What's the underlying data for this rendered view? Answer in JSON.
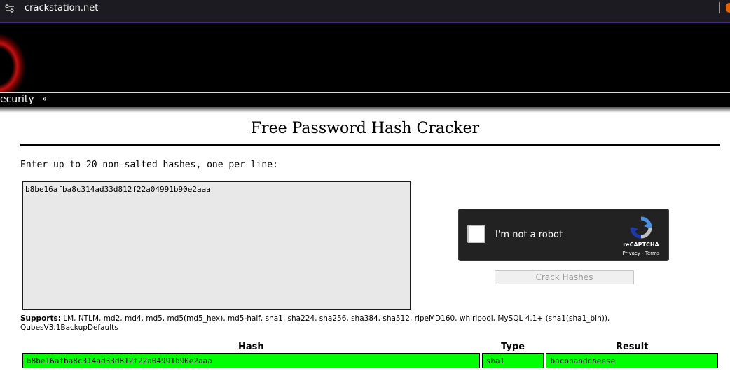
{
  "browser": {
    "url": "crackstation.net",
    "site_info_icon": "tune-icon"
  },
  "nav": {
    "label": "ecurity",
    "chevron": "»"
  },
  "page": {
    "title": "Free Password Hash Cracker",
    "instructions": "Enter up to 20 non-salted hashes, one per line:",
    "hash_input_value": "b8be16afba8c314ad33d812f22a04991b90e2aaa",
    "crack_button_label": "Crack Hashes",
    "supports_label": "Supports:",
    "supports_text": " LM, NTLM, md2, md4, md5, md5(md5_hex), md5-half, sha1, sha224, sha256, sha384, sha512, ripeMD160, whirlpool, MySQL 4.1+ (sha1(sha1_bin)), QubesV3.1BackupDefaults"
  },
  "captcha": {
    "label": "I'm not a robot",
    "brand": "reCAPTCHA",
    "links": "Privacy - Terms"
  },
  "results": {
    "headers": [
      "Hash",
      "Type",
      "Result"
    ],
    "rows": [
      {
        "hash": "b8be16afba8c314ad33d812f22a04991b90e2aaa",
        "type": "sha1",
        "result": "baconandcheese"
      }
    ],
    "row_color": "#00ff00"
  }
}
